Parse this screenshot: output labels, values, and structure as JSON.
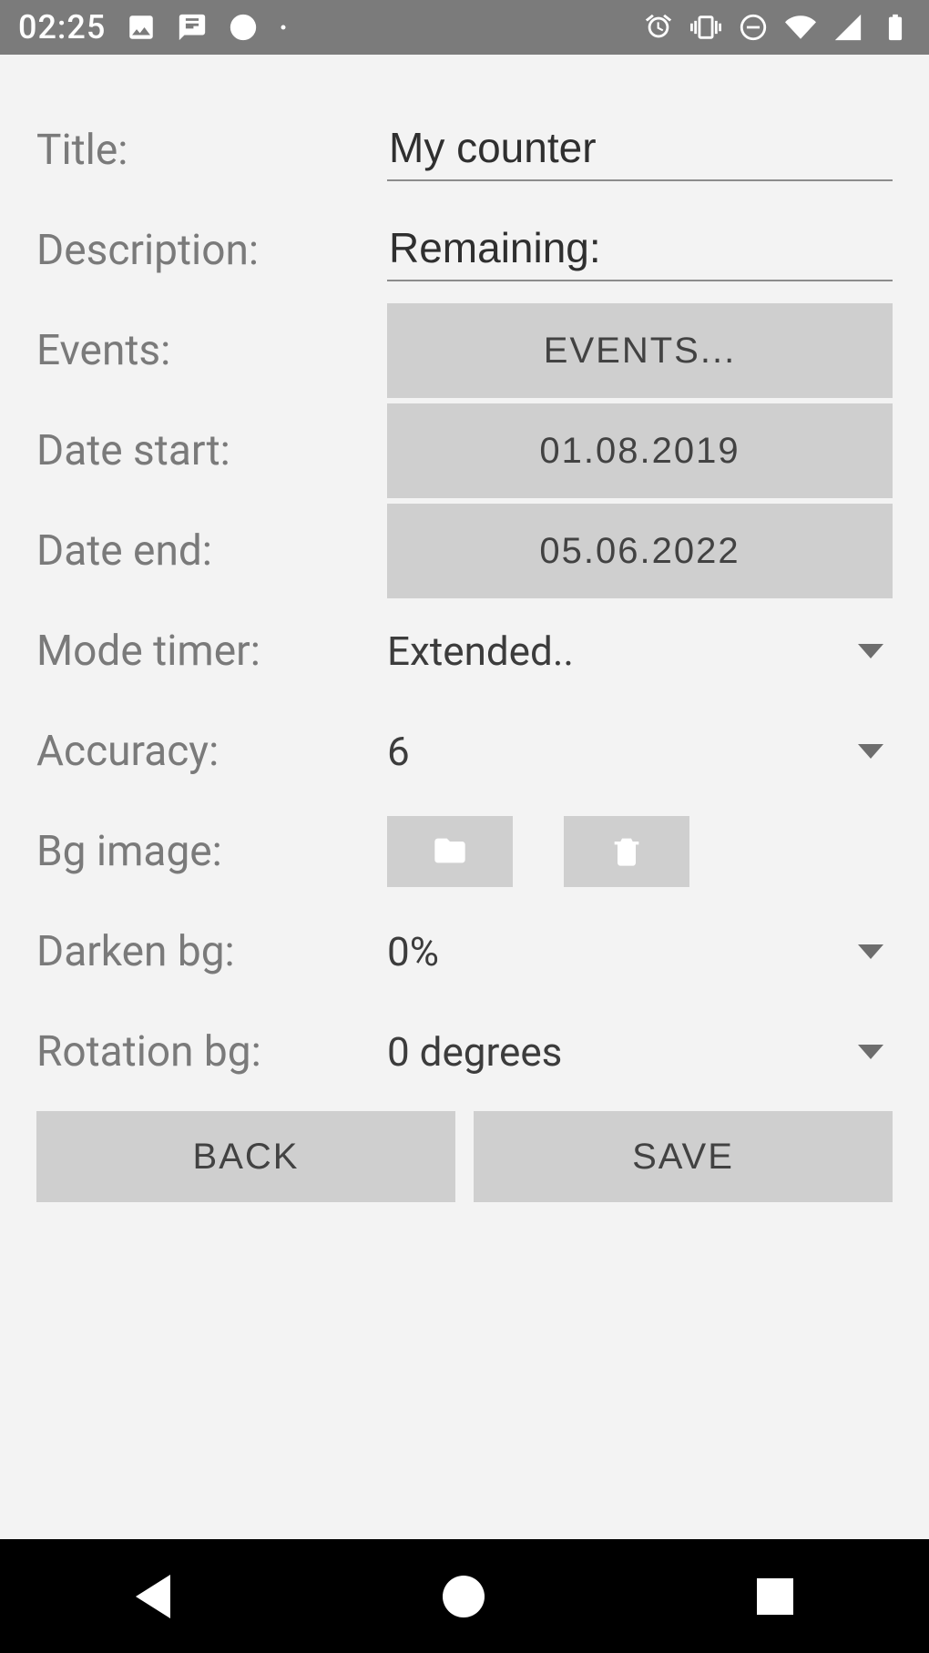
{
  "status": {
    "time": "02:25"
  },
  "form": {
    "title_label": "Title:",
    "title_value": "My counter",
    "description_label": "Description:",
    "description_value": "Remaining:",
    "events_label": "Events:",
    "events_button": "EVENTS...",
    "date_start_label": "Date start:",
    "date_start_value": "01.08.2019",
    "date_end_label": "Date end:",
    "date_end_value": "05.06.2022",
    "mode_timer_label": "Mode timer:",
    "mode_timer_value": "Extended..",
    "accuracy_label": "Accuracy:",
    "accuracy_value": "6",
    "bg_image_label": "Bg image:",
    "darken_bg_label": "Darken bg:",
    "darken_bg_value": "0%",
    "rotation_bg_label": "Rotation bg:",
    "rotation_bg_value": "0 degrees",
    "back_button": "BACK",
    "save_button": "SAVE"
  }
}
